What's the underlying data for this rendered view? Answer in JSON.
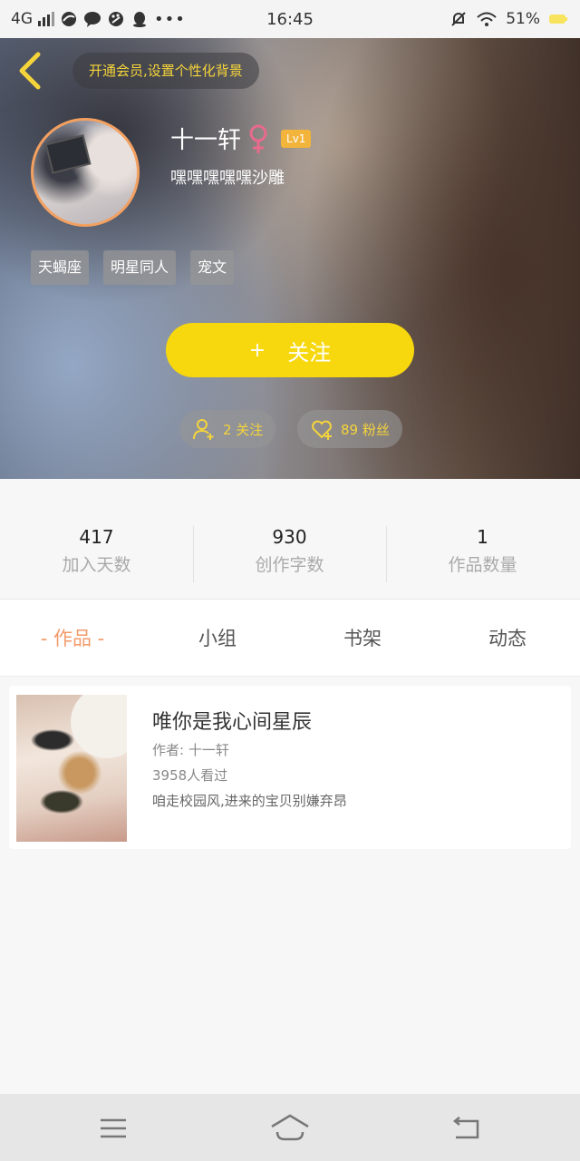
{
  "status_bar": {
    "network": "4G",
    "time": "16:45",
    "battery": "51%"
  },
  "header": {
    "vip_prompt": "开通会员,设置个性化背景",
    "username": "十一轩",
    "level": "Lv1",
    "signature": "嘿嘿嘿嘿嘿沙雕",
    "tags": [
      "天蝎座",
      "明星同人",
      "宠文"
    ],
    "follow_label": "关注",
    "follow_plus": "+",
    "following_text": "2 关注",
    "fans_text": "89 粉丝"
  },
  "stats": [
    {
      "value": "417",
      "label": "加入天数"
    },
    {
      "value": "930",
      "label": "创作字数"
    },
    {
      "value": "1",
      "label": "作品数量"
    }
  ],
  "tabs": [
    {
      "label": "- 作品 -",
      "active": true
    },
    {
      "label": "小组",
      "active": false
    },
    {
      "label": "书架",
      "active": false
    },
    {
      "label": "动态",
      "active": false
    }
  ],
  "works": [
    {
      "title": "唯你是我心间星辰",
      "author": "作者: 十一轩",
      "views": "3958人看过",
      "description": "咱走校园风,进来的宝贝别嫌弃昂"
    }
  ],
  "colors": {
    "accent_yellow": "#f7d80e",
    "vip_text": "#f5d43b",
    "active_tab": "#f39a6a",
    "female_pink": "#e86a8c",
    "level_badge": "#f2b43b"
  },
  "icons": {
    "back": "chevron-left-icon",
    "gender": "female-icon",
    "following": "user-add-icon",
    "fans": "heart-plus-icon",
    "nav_menu": "menu-icon",
    "nav_home": "home-icon",
    "nav_back": "return-icon"
  }
}
